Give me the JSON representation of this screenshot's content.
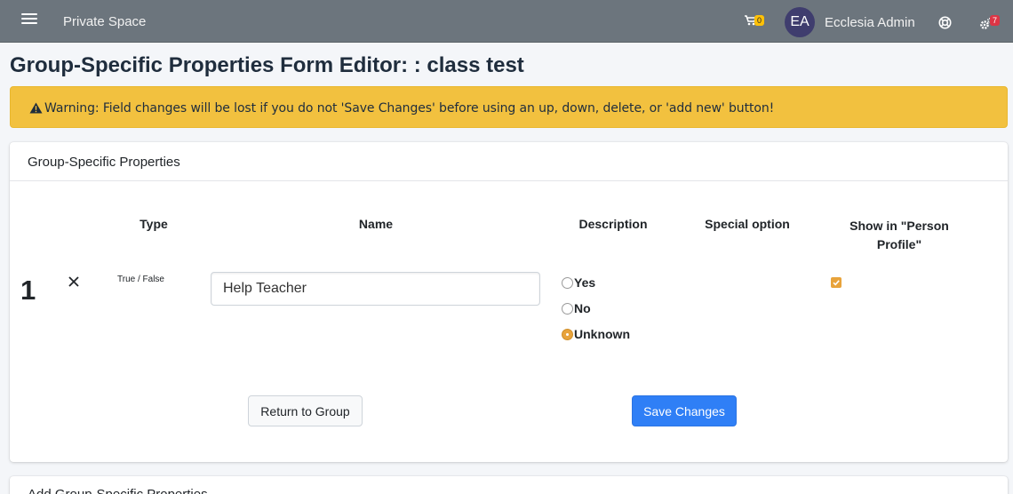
{
  "navbar": {
    "brand": "Private Space",
    "cart_count": "0",
    "avatar_initials": "EA",
    "user_name": "Ecclesia Admin",
    "settings_badge": "7"
  },
  "page": {
    "title": "Group-Specific Properties Form Editor: : class test"
  },
  "alert": {
    "text": "Warning: Field changes will be lost if you do not 'Save Changes' before using an up, down, delete, or 'add new' button!"
  },
  "card": {
    "title": "Group-Specific Properties",
    "headers": {
      "type": "Type",
      "name": "Name",
      "description": "Description",
      "special_option": "Special option",
      "show_in": "Show in \"Person Profile\""
    },
    "row": {
      "number": "1",
      "type": "True / False",
      "name_value": "Help Teacher",
      "options": [
        "Yes",
        "No",
        "Unknown"
      ],
      "selected_option": "Unknown",
      "show_in_profile": true
    },
    "buttons": {
      "return": "Return to Group",
      "save": "Save Changes"
    }
  },
  "card2": {
    "title": "Add Group-Specific Properties"
  },
  "colors": {
    "navbar": "#6c757d",
    "alert": "#f2c13f",
    "primary": "#2f7ff6",
    "accent": "#e8a33b"
  }
}
